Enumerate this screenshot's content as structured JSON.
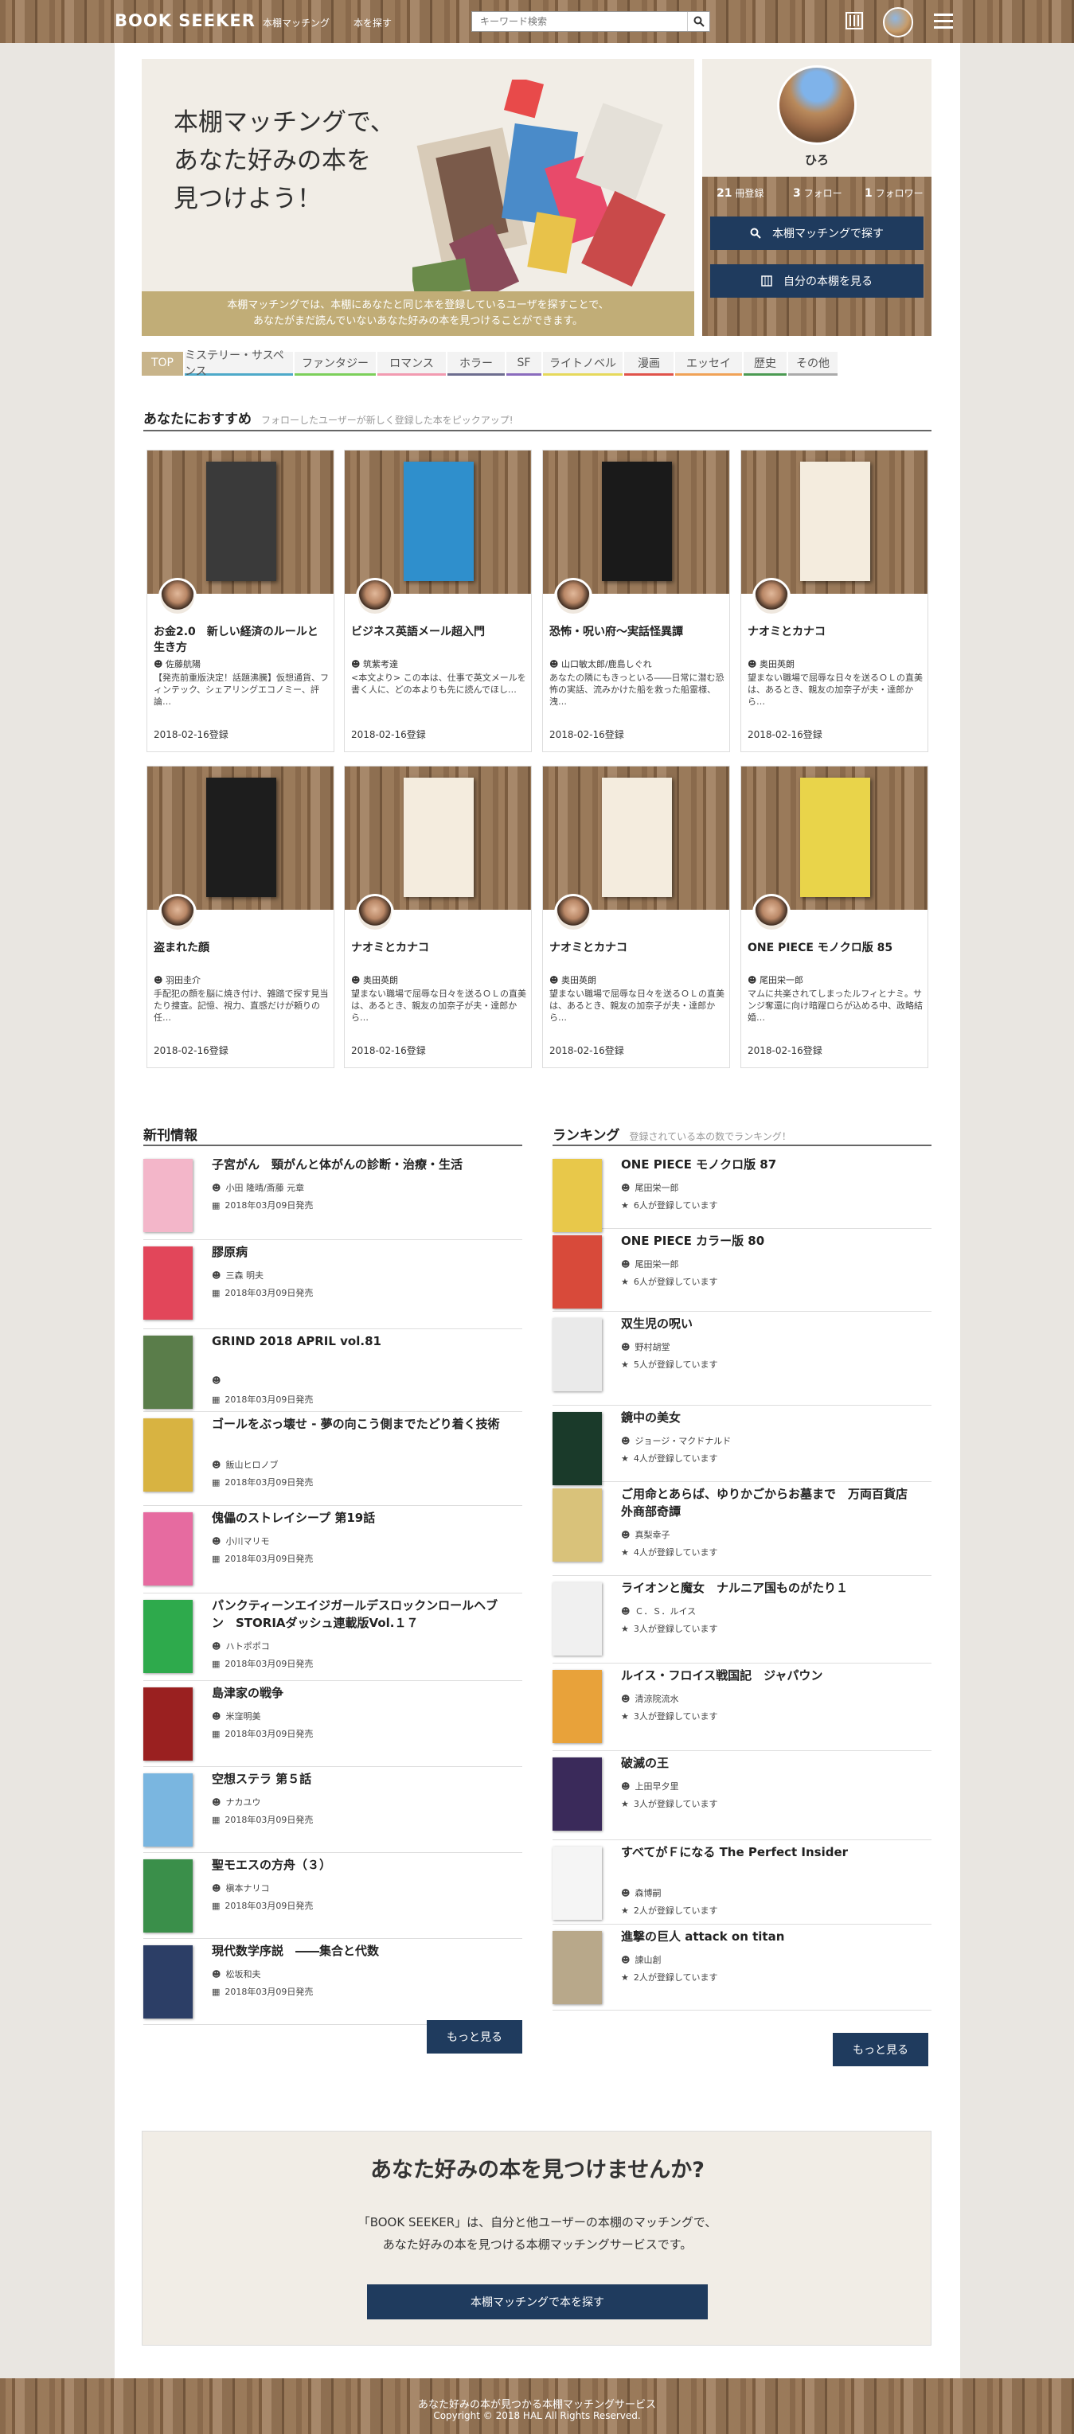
{
  "nav": {
    "logo": "BOOK SEEKER",
    "link_matching": "本棚マッチング",
    "link_search": "本を探す",
    "search_placeholder": "キーワード検索"
  },
  "hero": {
    "title_line1": "本棚マッチングで、",
    "title_line2": "あなた好みの本を",
    "title_line3": "見つけよう！",
    "caption_line1": "本棚マッチングでは、本棚にあなたと同じ本を登録しているユーザを探すことで、",
    "caption_line2": "あなたがまだ読んでいないあなた好みの本を見つけることができます。"
  },
  "profile": {
    "name": "ひろ",
    "books_count": "21",
    "books_label": "冊登録",
    "follow_count": "3",
    "follow_label": "フォロー",
    "follower_count": "1",
    "follower_label": "フォロワー",
    "btn_match": "本棚マッチングで探す",
    "btn_shelf": "自分の本棚を見る"
  },
  "tabs": [
    {
      "label": "TOP",
      "color": "#c8b48a"
    },
    {
      "label": "ミステリー・サスペンス",
      "color": "#4da9c9"
    },
    {
      "label": "ファンタジー",
      "color": "#7ccf5a"
    },
    {
      "label": "ロマンス",
      "color": "#f29ab0"
    },
    {
      "label": "ホラー",
      "color": "#6d6d8f"
    },
    {
      "label": "SF",
      "color": "#8a6bbd"
    },
    {
      "label": "ライトノベル",
      "color": "#e6d95b"
    },
    {
      "label": "漫画",
      "color": "#e0534a"
    },
    {
      "label": "エッセイ",
      "color": "#f0a257"
    },
    {
      "label": "歴史",
      "color": "#4b9a52"
    },
    {
      "label": "その他",
      "color": "#aaaaaa"
    }
  ],
  "recommend": {
    "heading": "あなたにおすすめ",
    "sub": "フォローしたユーザーが新しく登録した本をピックアップ!",
    "cards": [
      {
        "title": "お金2.0　新しい経済のルールと生き方",
        "author": "佐藤航陽",
        "desc": "【発売前重版決定！話題沸騰】仮想通貨、フィンテック、シェアリングエコノミー、評論…",
        "date": "2018-02-16登録",
        "cover": "#3a3a3a"
      },
      {
        "title": "ビジネス英語メール超入門",
        "author": "筑紫考達",
        "desc": "<本文より> この本は、仕事で英文メールを書く人に、どの本よりも先に読んでほし…",
        "date": "2018-02-16登録",
        "cover": "#2f8fcc"
      },
      {
        "title": "恐怖・呪い府〜実話怪異譚",
        "author": "山口敏太郎/鹿島しぐれ",
        "desc": "あなたの隣にもきっといる――日常に潜む恐怖の実話、流みかけた船を救った船霊様、洩…",
        "date": "2018-02-16登録",
        "cover": "#1a1a1a"
      },
      {
        "title": "ナオミとカナコ",
        "author": "奥田英朗",
        "desc": "望まない職場で屈辱な日々を送るＯＬの直美は、あるとき、親友の加奈子が夫・達郎から…",
        "date": "2018-02-16登録",
        "cover": "#f4ecde"
      },
      {
        "title": "盗まれた顔",
        "author": "羽田圭介",
        "desc": "手配犯の顔を脳に焼き付け、雑踏で探す見当たり捜査。記憶、視力、直感だけが頼りの任…",
        "date": "2018-02-16登録",
        "cover": "#1d1d1d"
      },
      {
        "title": "ナオミとカナコ",
        "author": "奥田英朗",
        "desc": "望まない職場で屈辱な日々を送るＯＬの直美は、あるとき、親友の加奈子が夫・達郎から…",
        "date": "2018-02-16登録",
        "cover": "#f4ecde"
      },
      {
        "title": "ナオミとカナコ",
        "author": "奥田英朗",
        "desc": "望まない職場で屈辱な日々を送るＯＬの直美は、あるとき、親友の加奈子が夫・達郎から…",
        "date": "2018-02-16登録",
        "cover": "#f4ecde"
      },
      {
        "title": "ONE PIECE モノクロ版 85",
        "author": "尾田栄一郎",
        "desc": "マムに共楽されてしまったルフィとナミ。サンジ奪還に向け暗躍ロらが込める中、政略結婚…",
        "date": "2018-02-16登録",
        "cover": "#e9d44a"
      }
    ]
  },
  "new_releases": {
    "heading": "新刊情報",
    "more": "もっと見る",
    "items": [
      {
        "title": "子宮がん　頸がんと体がんの診断・治療・生活",
        "author": "小田 隆晴/斎藤 元章",
        "date": "2018年03月09日発売",
        "thumb": "#f3b6c9"
      },
      {
        "title": "膠原病",
        "author": "三森 明夫",
        "date": "2018年03月09日発売",
        "thumb": "#e2465a"
      },
      {
        "title": "GRIND 2018 APRIL vol.81",
        "author": "",
        "date": "2018年03月09日発売",
        "thumb": "#5a7d4a"
      },
      {
        "title": "ゴールをぶっ壊せ - 夢の向こう側までたどり着く技術",
        "author": "飯山ヒロノブ",
        "date": "2018年03月09日発売",
        "thumb": "#d8b341"
      },
      {
        "title": "傀儡のストレイシープ 第19話",
        "author": "小川マリモ",
        "date": "2018年03月09日発売",
        "thumb": "#e66ba0"
      },
      {
        "title": "パンクティーンエイジガールデスロックンロールヘブン　STORIAダッシュ連載版Vol.１７",
        "author": "ハトポポコ",
        "date": "2018年03月09日発売",
        "thumb": "#2eaa4c"
      },
      {
        "title": "島津家の戦争",
        "author": "米窪明美",
        "date": "2018年03月09日発売",
        "thumb": "#9a2020"
      },
      {
        "title": "空想ステラ 第５話",
        "author": "ナカユウ",
        "date": "2018年03月09日発売",
        "thumb": "#7ab6e0"
      },
      {
        "title": "聖モエスの方舟（３）",
        "author": "槇本ナリコ",
        "date": "2018年03月09日発売",
        "thumb": "#3a8f4a"
      },
      {
        "title": "現代数学序説　――集合と代数",
        "author": "松坂和夫",
        "date": "2018年03月09日発売",
        "thumb": "#2c3e66"
      }
    ]
  },
  "ranking": {
    "heading": "ランキング",
    "sub": "登録されている本の数でランキング！",
    "more": "もっと見る",
    "items": [
      {
        "title": "ONE PIECE モノクロ版 87",
        "author": "尾田栄一郎",
        "count": "6人が登録しています",
        "thumb": "#e8c84a"
      },
      {
        "title": "ONE PIECE カラー版 80",
        "author": "尾田栄一郎",
        "count": "6人が登録しています",
        "thumb": "#d84a3a"
      },
      {
        "title": "双生児の呪い",
        "author": "野村胡堂",
        "count": "5人が登録しています",
        "thumb": "#eaeaea"
      },
      {
        "title": "鏡中の美女",
        "author": "ジョージ・マクドナルド",
        "count": "4人が登録しています",
        "thumb": "#1a3a2a"
      },
      {
        "title": "ご用命とあらば、ゆりかごからお墓まで　万両百貨店外商部奇譚",
        "author": "真梨幸子",
        "count": "4人が登録しています",
        "thumb": "#d9c27a"
      },
      {
        "title": "ライオンと魔女　ナルニア国ものがたり１",
        "author": "Ｃ．Ｓ．ルイス",
        "count": "3人が登録しています",
        "thumb": "#f0f0f0"
      },
      {
        "title": "ルイス・フロイス戦国記　ジャパウン",
        "author": "清涼院流水",
        "count": "3人が登録しています",
        "thumb": "#e8a23a"
      },
      {
        "title": "破滅の王",
        "author": "上田早夕里",
        "count": "3人が登録しています",
        "thumb": "#3a2a5a"
      },
      {
        "title": "すべてがＦになる The Perfect Insider",
        "author": "森博嗣",
        "count": "2人が登録しています",
        "thumb": "#f5f5f5"
      },
      {
        "title": "進撃の巨人 attack on titan",
        "author": "諫山創",
        "count": "2人が登録しています",
        "thumb": "#b8a88a"
      }
    ]
  },
  "cta": {
    "title": "あなた好みの本を見つけませんか?",
    "line1": "「BOOK SEEKER」は、自分と他ユーザーの本棚のマッチングで、",
    "line2": "あなた好みの本を見つける本棚マッチングサービスです。",
    "button": "本棚マッチングで本を探す"
  },
  "footer": {
    "line1": "あなた好みの本が見つかる本棚マッチングサービス",
    "line2": "Copyright © 2018 HAL All Rights Reserved."
  }
}
